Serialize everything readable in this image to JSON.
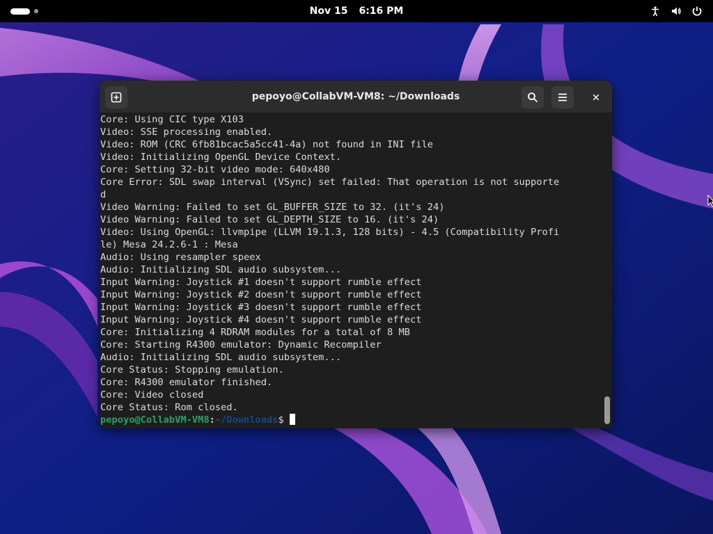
{
  "topbar": {
    "date": "Nov 15",
    "time": "6:16 PM",
    "tray_icons": [
      "accessibility-icon",
      "volume-icon",
      "power-icon"
    ]
  },
  "window": {
    "title": "pepoyo@CollabVM-VM8: ~/Downloads",
    "buttons": [
      "new-tab-icon",
      "search-icon",
      "hamburger-menu-icon",
      "close-icon"
    ]
  },
  "terminal": {
    "lines": [
      "Core: Using CIC type X103",
      "Video: SSE processing enabled.",
      "Video: ROM (CRC 6fb81bcac5a5cc41-4a) not found in INI file",
      "Video: Initializing OpenGL Device Context.",
      "Core: Setting 32-bit video mode: 640x480",
      "Core Error: SDL swap interval (VSync) set failed: That operation is not supporte",
      "d",
      "Video Warning: Failed to set GL_BUFFER_SIZE to 32. (it's 24)",
      "Video Warning: Failed to set GL_DEPTH_SIZE to 16. (it's 24)",
      "Video: Using OpenGL: llvmpipe (LLVM 19.1.3, 128 bits) - 4.5 (Compatibility Profi",
      "le) Mesa 24.2.6-1 : Mesa",
      "Audio: Using resampler speex",
      "Audio: Initializing SDL audio subsystem...",
      "Input Warning: Joystick #1 doesn't support rumble effect",
      "Input Warning: Joystick #2 doesn't support rumble effect",
      "Input Warning: Joystick #3 doesn't support rumble effect",
      "Input Warning: Joystick #4 doesn't support rumble effect",
      "Core: Initializing 4 RDRAM modules for a total of 8 MB",
      "Core: Starting R4300 emulator: Dynamic Recompiler",
      "Audio: Initializing SDL audio subsystem...",
      "Core Status: Stopping emulation.",
      "Core: R4300 emulator finished.",
      "Core: Video closed",
      "Core Status: Rom closed."
    ],
    "prompt": {
      "user_host": "pepoyo@CollabVM-VM8",
      "colon": ":",
      "path": "~/Downloads",
      "sign": "$"
    },
    "colors": {
      "background": "#1e1e1e",
      "text": "#dcdcdc",
      "prompt_user": "#26a269",
      "prompt_path": "#12488b"
    }
  }
}
